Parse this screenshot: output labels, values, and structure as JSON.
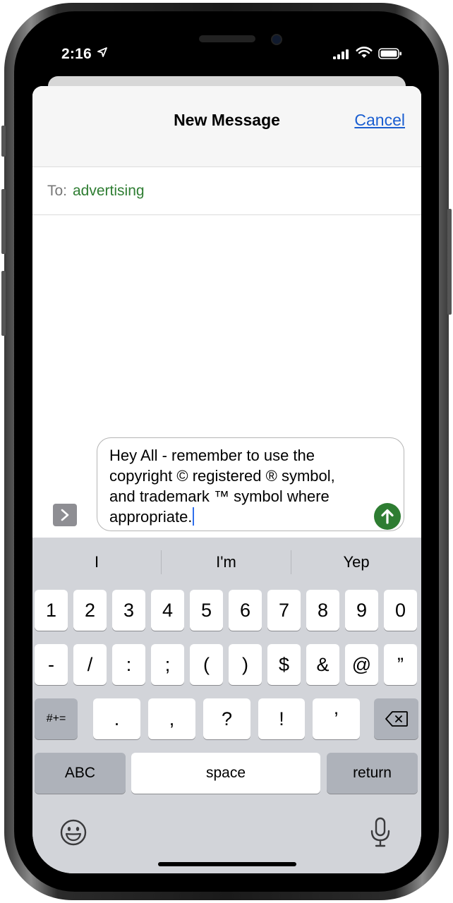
{
  "status_bar": {
    "time": "2:16",
    "icons": [
      "location-arrow-icon",
      "cellular-signal-icon",
      "wifi-icon",
      "battery-icon"
    ]
  },
  "header": {
    "title": "New Message",
    "cancel_label": "Cancel"
  },
  "recipient": {
    "label": "To:",
    "value": "advertising"
  },
  "compose": {
    "text": "Hey All - remember to use the\ncopyright © registered ® symbol,\nand trademark ™ symbol where\nappropriate."
  },
  "keyboard": {
    "suggestions": [
      "I",
      "I'm",
      "Yep"
    ],
    "row1": [
      "1",
      "2",
      "3",
      "4",
      "5",
      "6",
      "7",
      "8",
      "9",
      "0"
    ],
    "row2": [
      "-",
      "/",
      ":",
      ";",
      "(",
      ")",
      "$",
      "&",
      "@",
      "”"
    ],
    "row3_left": "#+=",
    "row3": [
      ".",
      ",",
      "?",
      "!",
      "’"
    ],
    "abc_label": "ABC",
    "space_label": "space",
    "return_label": "return"
  },
  "colors": {
    "accent_link": "#1b5fd1",
    "recipient_green": "#2e7d32",
    "send_green": "#2e7d32",
    "keyboard_bg": "#d2d4d9"
  }
}
